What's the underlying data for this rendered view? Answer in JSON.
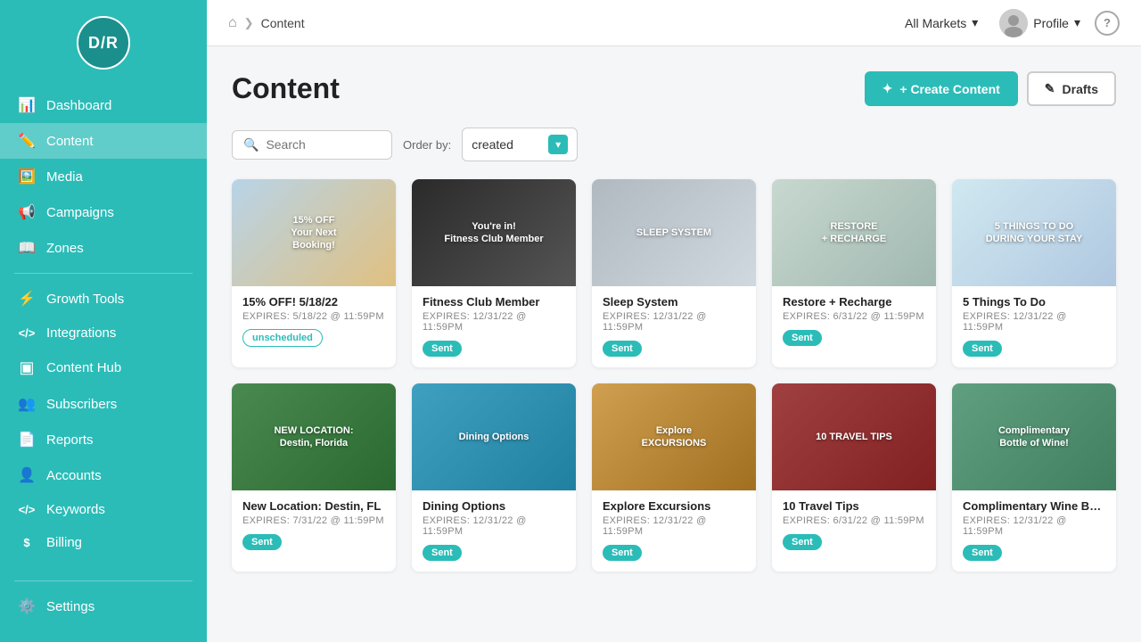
{
  "logo": {
    "text": "D/R"
  },
  "sidebar": {
    "items": [
      {
        "id": "dashboard",
        "label": "Dashboard",
        "icon": "📊",
        "active": false
      },
      {
        "id": "content",
        "label": "Content",
        "icon": "✏️",
        "active": true
      },
      {
        "id": "media",
        "label": "Media",
        "icon": "🖼️",
        "active": false
      },
      {
        "id": "campaigns",
        "label": "Campaigns",
        "icon": "📢",
        "active": false
      },
      {
        "id": "zones",
        "label": "Zones",
        "icon": "📖",
        "active": false
      },
      {
        "id": "growth-tools",
        "label": "Growth Tools",
        "icon": "⚡",
        "active": false
      },
      {
        "id": "integrations",
        "label": "Integrations",
        "icon": "</>",
        "active": false
      },
      {
        "id": "content-hub",
        "label": "Content Hub",
        "icon": "□",
        "active": false
      },
      {
        "id": "subscribers",
        "label": "Subscribers",
        "icon": "👥",
        "active": false
      },
      {
        "id": "reports",
        "label": "Reports",
        "icon": "📄",
        "active": false
      },
      {
        "id": "accounts",
        "label": "Accounts",
        "icon": "👤",
        "active": false
      },
      {
        "id": "keywords",
        "label": "Keywords",
        "icon": "</>",
        "active": false
      },
      {
        "id": "billing",
        "label": "Billing",
        "icon": "$",
        "active": false
      }
    ],
    "settings_label": "Settings"
  },
  "topbar": {
    "breadcrumb": "Content",
    "market_label": "All Markets",
    "profile_label": "Profile",
    "help_label": "?"
  },
  "page": {
    "title": "Content",
    "create_button": "+ Create Content",
    "drafts_button": "Drafts",
    "order_label": "Order by:",
    "order_value": "created",
    "search_placeholder": "Search"
  },
  "cards": [
    {
      "id": 1,
      "title": "15% OFF! 5/18/22",
      "expires": "EXPIRES: 5/18/22 @ 11:59PM",
      "badge": "unscheduled",
      "badge_text": "unscheduled",
      "thumb_class": "thumb-1",
      "thumb_text": "15% OFF\nYour Next\nBooking!"
    },
    {
      "id": 2,
      "title": "Fitness Club Member",
      "expires": "EXPIRES: 12/31/22 @ 11:59PM",
      "badge": "sent",
      "badge_text": "Sent",
      "thumb_class": "thumb-2",
      "thumb_text": "You're in!\nFitness Club Member"
    },
    {
      "id": 3,
      "title": "Sleep System",
      "expires": "EXPIRES: 12/31/22 @ 11:59PM",
      "badge": "sent",
      "badge_text": "Sent",
      "thumb_class": "thumb-3",
      "thumb_text": "SLEEP SYSTEM"
    },
    {
      "id": 4,
      "title": "Restore + Recharge",
      "expires": "EXPIRES: 6/31/22 @ 11:59PM",
      "badge": "sent",
      "badge_text": "Sent",
      "thumb_class": "thumb-4",
      "thumb_text": "RESTORE\n+ RECHARGE"
    },
    {
      "id": 5,
      "title": "5 Things To Do",
      "expires": "EXPIRES: 12/31/22 @ 11:59PM",
      "badge": "sent",
      "badge_text": "Sent",
      "thumb_class": "thumb-5",
      "thumb_text": "5 THINGS TO DO\nDURING YOUR STAY"
    },
    {
      "id": 6,
      "title": "New Location: Destin, FL",
      "expires": "EXPIRES: 7/31/22 @ 11:59PM",
      "badge": "sent",
      "badge_text": "Sent",
      "thumb_class": "thumb-6",
      "thumb_text": "NEW LOCATION:\nDestin, Florida"
    },
    {
      "id": 7,
      "title": "Dining Options",
      "expires": "EXPIRES: 12/31/22 @ 11:59PM",
      "badge": "sent",
      "badge_text": "Sent",
      "thumb_class": "thumb-7",
      "thumb_text": "Dining Options"
    },
    {
      "id": 8,
      "title": "Explore Excursions",
      "expires": "EXPIRES: 12/31/22 @ 11:59PM",
      "badge": "sent",
      "badge_text": "Sent",
      "thumb_class": "thumb-8",
      "thumb_text": "Explore\nEXCURSIONS"
    },
    {
      "id": 9,
      "title": "10 Travel Tips",
      "expires": "EXPIRES: 6/31/22 @ 11:59PM",
      "badge": "sent",
      "badge_text": "Sent",
      "thumb_class": "thumb-9",
      "thumb_text": "10 TRAVEL TIPS"
    },
    {
      "id": 10,
      "title": "Complimentary Wine Bottle",
      "expires": "EXPIRES: 12/31/22 @ 11:59PM",
      "badge": "sent",
      "badge_text": "Sent",
      "thumb_class": "thumb-10",
      "thumb_text": "Complimentary\nBottle of Wine!"
    }
  ]
}
